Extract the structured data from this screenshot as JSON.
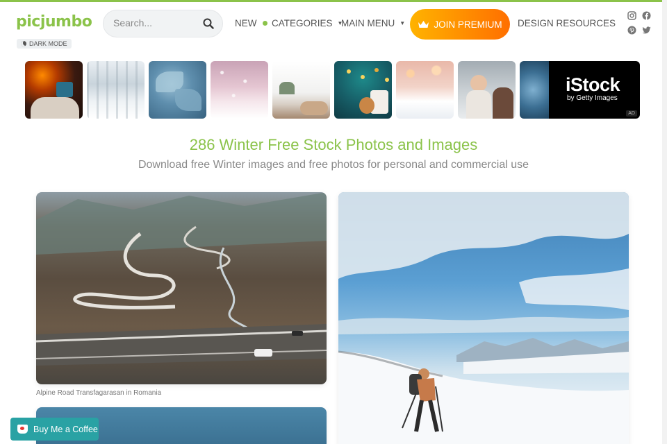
{
  "header": {
    "logo": "picjumbo",
    "dark_mode_label": "DARK MODE",
    "search_placeholder": "Search...",
    "nav": [
      {
        "label": "NEW"
      },
      {
        "label": "CATEGORIES"
      },
      {
        "label": "MAIN MENU"
      }
    ],
    "premium_label": "JOIN PREMIUM",
    "design_resources": "DESIGN RESOURCES",
    "social_icons": [
      "instagram-icon",
      "facebook-icon",
      "pinterest-icon",
      "twitter-icon"
    ]
  },
  "thumbnails": [
    {
      "name": "fireplace-mug"
    },
    {
      "name": "snowy-forest"
    },
    {
      "name": "frozen-leaves"
    },
    {
      "name": "pink-snowfall"
    },
    {
      "name": "winter-window"
    },
    {
      "name": "christmas-cookie"
    },
    {
      "name": "snowy-path-bokeh"
    },
    {
      "name": "couple-snow"
    },
    {
      "name": "blue-frost"
    }
  ],
  "ad": {
    "brand": "iStock",
    "sub": "by Getty Images",
    "tag": "AD"
  },
  "page": {
    "title": "286 Winter Free Stock Photos and Images",
    "subtitle": "Download free Winter images and free photos for personal and commercial use"
  },
  "photos": [
    {
      "caption": "Alpine Road Transfagarasan in Romania"
    }
  ],
  "coffee_button": "Buy Me a Coffee",
  "colors": {
    "brand": "#8bc34a",
    "premium_start": "#ffb300",
    "premium_end": "#ff6f00",
    "coffee": "#29a2a4"
  }
}
